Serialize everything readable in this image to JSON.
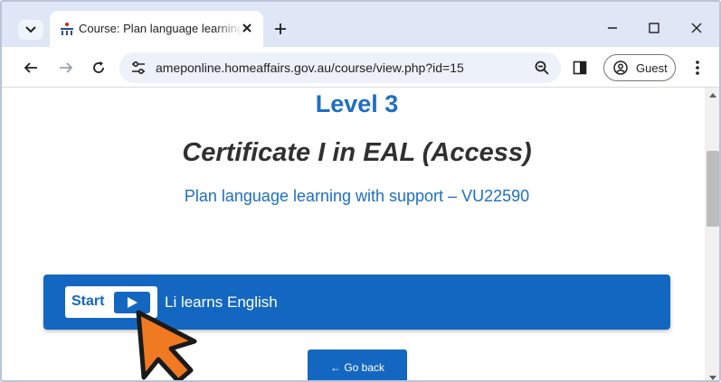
{
  "browser": {
    "tab": {
      "title": "Course: Plan language learning with support",
      "favicon": "amep-logo-icon",
      "close": "close-icon"
    },
    "new_tab": "plus-icon",
    "omnibox": {
      "url": "ameponline.homeaffairs.gov.au/course/view.php?id=15"
    },
    "profile": {
      "label": "Guest"
    }
  },
  "page": {
    "level": "Level 3",
    "certificate": "Certificate I in EAL (Access)",
    "unit": "Plan language learning with support – VU22590",
    "activity": {
      "start_label": "Start",
      "title": "Li learns English"
    },
    "go_back": "← Go back"
  },
  "colors": {
    "accent": "#1467c1",
    "heading": "#1d6fc1",
    "tabbar": "#dfe7f6",
    "cursor": "#f07a22"
  }
}
